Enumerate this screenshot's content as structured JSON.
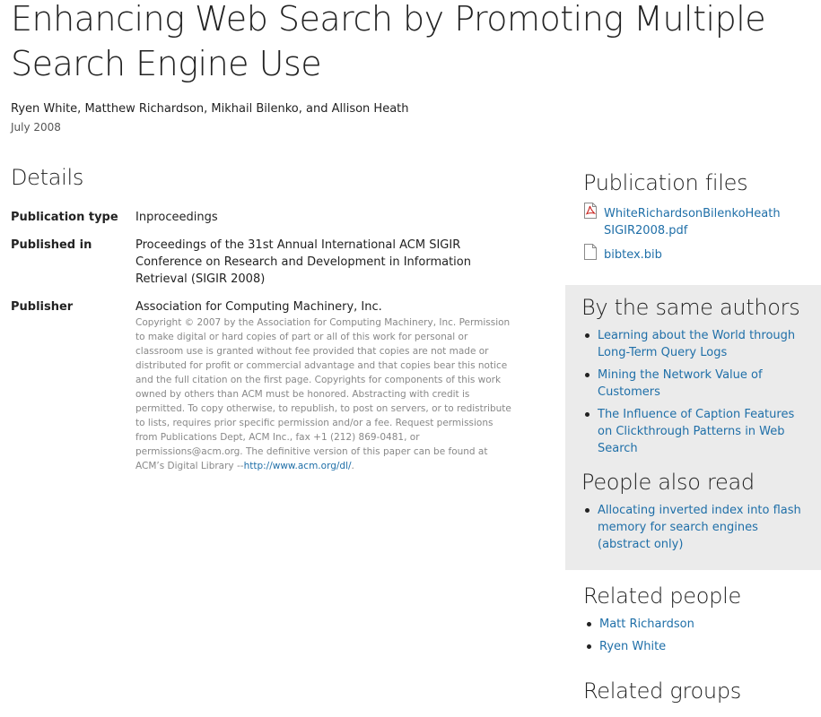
{
  "title": "Enhancing Web Search by Promoting Multiple Search Engine Use",
  "authors": "Ryen White, Matthew Richardson, Mikhail Bilenko, and Allison Heath",
  "date": "July 2008",
  "details": {
    "heading": "Details",
    "publication_type_label": "Publication type",
    "publication_type_value": "Inproceedings",
    "published_in_label": "Published in",
    "published_in_value": "Proceedings of the 31st Annual International ACM SIGIR Conference on Research and Development in Information Retrieval (SIGIR 2008)",
    "publisher_label": "Publisher",
    "publisher_value": "Association for Computing Machinery, Inc.",
    "copyright_text": "Copyright © 2007 by the Association for Computing Machinery, Inc. Permission to make digital or hard copies of part or all of this work for personal or classroom use is granted without fee provided that copies are not made or distributed for profit or commercial advantage and that copies bear this notice and the full citation on the first page. Copyrights for components of this work owned by others than ACM must be honored. Abstracting with credit is permitted. To copy otherwise, to republish, to post on servers, or to redistribute to lists, requires prior specific permission and/or a fee. Request permissions from Publications Dept, ACM Inc., fax +1 (212) 869-0481, or permissions@acm.org. The definitive version of this paper can be found at ACM’s Digital Library --",
    "copyright_link": "http://www.acm.org/dl/",
    "copyright_end": "."
  },
  "publication_files": {
    "heading": "Publication files",
    "pdf_line1": "WhiteRichardsonBilenkoHeath",
    "pdf_line2": "SIGIR2008.pdf",
    "bib": "bibtex.bib",
    "pdf_icon": "pdf-file-icon",
    "bib_icon": "document-file-icon"
  },
  "same_authors": {
    "heading": "By the same authors",
    "items": [
      "Learning about the World through Long-Term Query Logs",
      "Mining the Network Value of Customers",
      "The Influence of Caption Features on Clickthrough Patterns in Web Search"
    ]
  },
  "people_also_read": {
    "heading": "People also read",
    "items": [
      "Allocating inverted index into flash memory for search engines (abstract only)"
    ]
  },
  "related_people": {
    "heading": "Related people",
    "items": [
      "Matt Richardson",
      "Ryen White"
    ]
  },
  "related_groups": {
    "heading": "Related groups"
  },
  "colors": {
    "link": "#1f6fa8",
    "sidebar_bg": "#ebebeb",
    "text": "#222222",
    "muted": "#888888"
  }
}
